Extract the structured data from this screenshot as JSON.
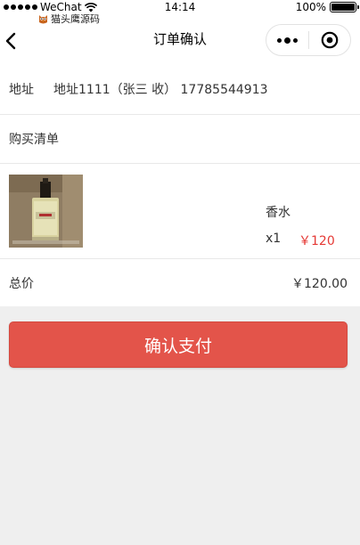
{
  "status_bar": {
    "carrier": "WeChat",
    "time": "14:14",
    "battery": "100%"
  },
  "watermark": {
    "text": "猫头鹰源码"
  },
  "nav": {
    "title": "订单确认"
  },
  "address": {
    "label": "地址",
    "value": "地址1111（张三 收） 17785544913"
  },
  "order_list": {
    "title": "购买清单",
    "items": [
      {
        "name": "香水",
        "quantity": "x1",
        "price": "￥120"
      }
    ]
  },
  "total": {
    "label": "总价",
    "value": "￥120.00"
  },
  "actions": {
    "pay_label": "确认支付"
  },
  "colors": {
    "accent": "#e3544a",
    "price": "#e53935",
    "background": "#efefef"
  }
}
